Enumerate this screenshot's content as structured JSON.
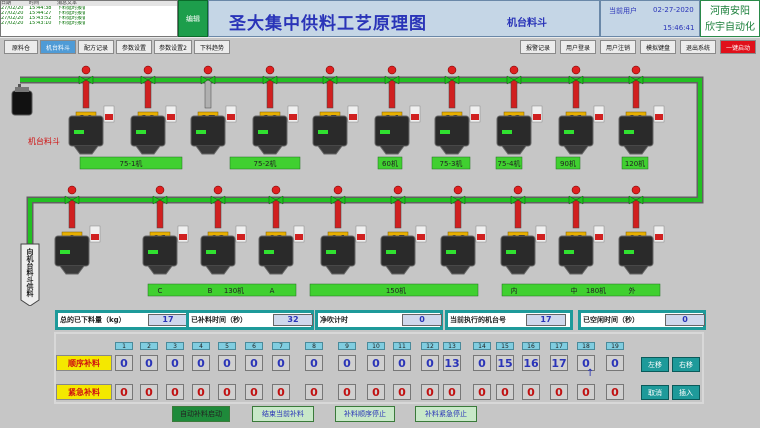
{
  "alarm": {
    "headers": [
      "日期",
      "时间",
      "消息文本"
    ],
    "rows": [
      [
        "27/02/20",
        "15:44:38",
        "下料延时报警"
      ],
      [
        "27/02/20",
        "15:44:27",
        "下料延时报警"
      ],
      [
        "27/02/20",
        "15:43:52",
        "下料延时报警"
      ],
      [
        "27/02/20",
        "15:43:10",
        "下料延时报警"
      ]
    ]
  },
  "header": {
    "edit_label": "编辑",
    "title": "圣大集中供料工艺原理图",
    "subtitle": "机台料斗",
    "user_label": "当前用户",
    "date": "02-27-2020",
    "time": "15:46:41",
    "company": [
      "河南安阳",
      "欣宇自动化"
    ]
  },
  "nav_left": [
    "原料仓",
    "机台料斗",
    "配方记录",
    "参数设置",
    "参数设置2",
    "下料趋势"
  ],
  "nav_right": [
    "报警记录",
    "用户登录",
    "用户注销",
    "模拟键盘",
    "退出系统",
    "一键启动"
  ],
  "colors": {
    "pipe": "#22c022",
    "riser_red": "#d02020",
    "riser_grey": "#b0b0b0",
    "accent": "#1e9a9a",
    "title": "#2a34b8"
  },
  "process": {
    "left_label": "机台料斗",
    "side_label": "向机台料斗供料",
    "hopper0": "0",
    "top_numbers": [
      "19",
      "18",
      "17",
      "16",
      "15",
      "14",
      "13",
      "12",
      "11",
      "10"
    ],
    "bottom_numbers": [
      "01",
      "02",
      "03",
      "04",
      "05",
      "06",
      "07",
      "08",
      "09"
    ],
    "top_machines": [
      "75-1机",
      "75-2机",
      "60机",
      "75-3机",
      "75-4机",
      "90机",
      "120机"
    ],
    "bottom_machines": [
      "C",
      "B",
      "130机",
      "A",
      "150机",
      "内",
      "中",
      "180机",
      "外"
    ],
    "mini_label": [
      "允许",
      "加料"
    ]
  },
  "status": [
    {
      "label": "总的已下料量（kg）",
      "value": "17"
    },
    {
      "label": "已补料时间（秒）",
      "value": "32"
    },
    {
      "label": "净吹计时",
      "value": "0"
    },
    {
      "label": "当前执行的机台号",
      "value": "17"
    },
    {
      "label": "已空闲时间（秒）",
      "value": "0"
    }
  ],
  "grid": {
    "seq_label": "顺序补料",
    "urg_label": "紧急补料",
    "numbers": [
      "1",
      "2",
      "3",
      "4",
      "5",
      "6",
      "7",
      "8",
      "9",
      "10",
      "11",
      "12",
      "13",
      "14",
      "15",
      "16",
      "17",
      "18",
      "19"
    ],
    "seq_values": [
      "0",
      "0",
      "0",
      "0",
      "0",
      "0",
      "0",
      "0",
      "0",
      "0",
      "0",
      "0",
      "13",
      "0",
      "15",
      "16",
      "17",
      "0",
      "0"
    ],
    "urg_values": [
      "0",
      "0",
      "0",
      "0",
      "0",
      "0",
      "0",
      "0",
      "0",
      "0",
      "0",
      "0",
      "0",
      "0",
      "0",
      "0",
      "0",
      "0",
      "0"
    ],
    "arrow": "↑",
    "left_move": "左移",
    "right_move": "右移",
    "cancel": "取消",
    "insert": "插入"
  },
  "bottom_buttons": [
    "自动补料启动",
    "结束当前补料",
    "补料顺序停止",
    "补料紧急停止"
  ]
}
